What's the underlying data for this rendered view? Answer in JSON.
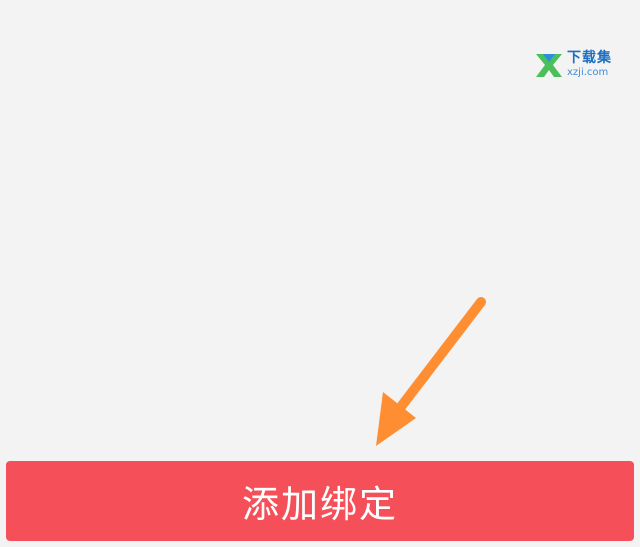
{
  "watermark": {
    "title": "下载集",
    "url": "xzji.com",
    "icon": "xzji-logo-icon"
  },
  "annotation": {
    "icon": "pointing-arrow-icon",
    "color": "#ff8e33"
  },
  "primary_action": {
    "label": "添加绑定",
    "color": "#f5505a"
  }
}
